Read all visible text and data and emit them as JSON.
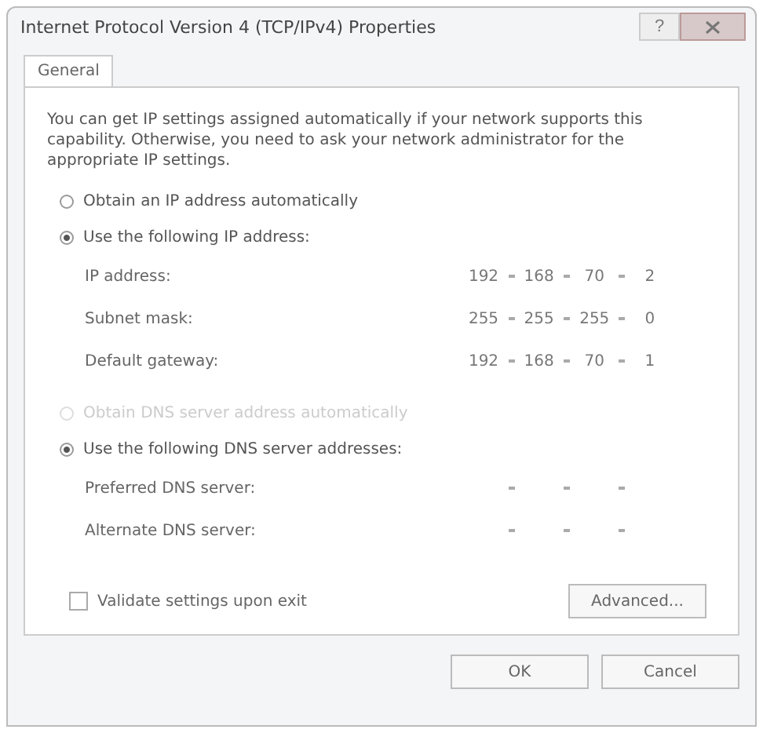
{
  "window": {
    "title": "Internet Protocol Version 4 (TCP/IPv4) Properties",
    "help": "?"
  },
  "tabs": [
    {
      "label": "General",
      "selected": true
    }
  ],
  "description": "You can get IP settings assigned automatically if your network supports this capability. Otherwise, you need to ask your network administrator for the appropriate IP settings.",
  "ip_options": [
    {
      "label": "Obtain an IP address automatically",
      "selected": false,
      "disabled": false
    },
    {
      "label": "Use the following IP address:",
      "selected": true,
      "disabled": false
    }
  ],
  "ip_fields": [
    {
      "label": "IP address:",
      "octets": [
        "192",
        "168",
        "70",
        "2"
      ]
    },
    {
      "label": "Subnet mask:",
      "octets": [
        "255",
        "255",
        "255",
        "0"
      ]
    },
    {
      "label": "Default gateway:",
      "octets": [
        "192",
        "168",
        "70",
        "1"
      ]
    }
  ],
  "dns_options": [
    {
      "label": "Obtain DNS server address automatically",
      "selected": false,
      "disabled": true
    },
    {
      "label": "Use the following DNS server addresses:",
      "selected": true,
      "disabled": false
    }
  ],
  "dns_fields": [
    {
      "label": "Preferred DNS server:"
    },
    {
      "label": "Alternate DNS server:"
    }
  ],
  "validate": {
    "label": "Validate settings upon exit",
    "checked": false
  },
  "advanced_button": "Advanced...",
  "buttons": [
    "OK",
    "Cancel"
  ]
}
